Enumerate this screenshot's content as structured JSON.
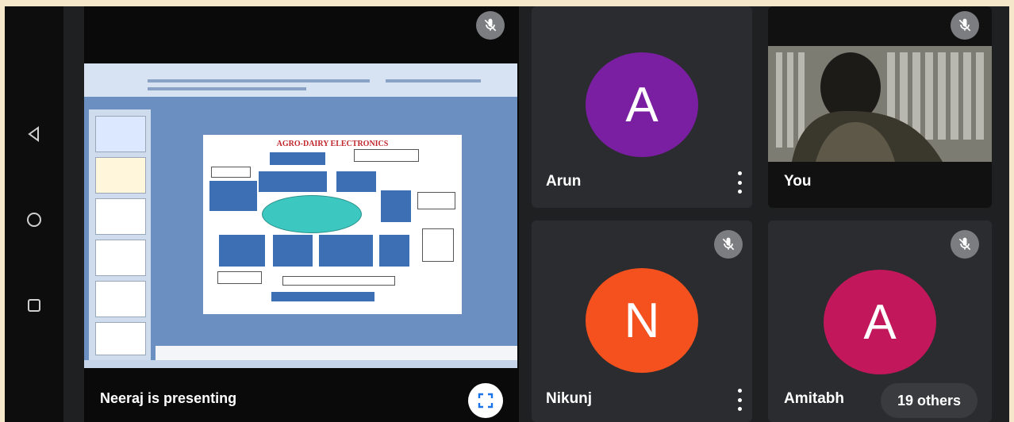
{
  "presentation": {
    "presenter_label": "Neeraj is presenting",
    "slide_title": "AGRO-DAIRY ELECTRONICS"
  },
  "participants": [
    {
      "initial": "A",
      "name": "Arun",
      "avatar_color": "#7a1fa2",
      "muted": true
    },
    {
      "initial": "",
      "name": "You",
      "muted": true,
      "video": true
    },
    {
      "initial": "N",
      "name": "Nikunj",
      "avatar_color": "#f4511e",
      "muted": true
    },
    {
      "initial": "A",
      "name": "Amitabh",
      "avatar_color": "#c2185b",
      "muted": true
    }
  ],
  "others_count_label": "19 others",
  "icons": {
    "nav_back": "triangle-back-icon",
    "nav_home": "circle-home-icon",
    "nav_recents": "square-recents-icon",
    "mute": "mic-off-icon",
    "fullscreen": "fullscreen-icon",
    "more": "more-vert-icon"
  },
  "colors": {
    "tile_bg": "#2b2c2f",
    "mute_bg": "#7c7d80"
  }
}
